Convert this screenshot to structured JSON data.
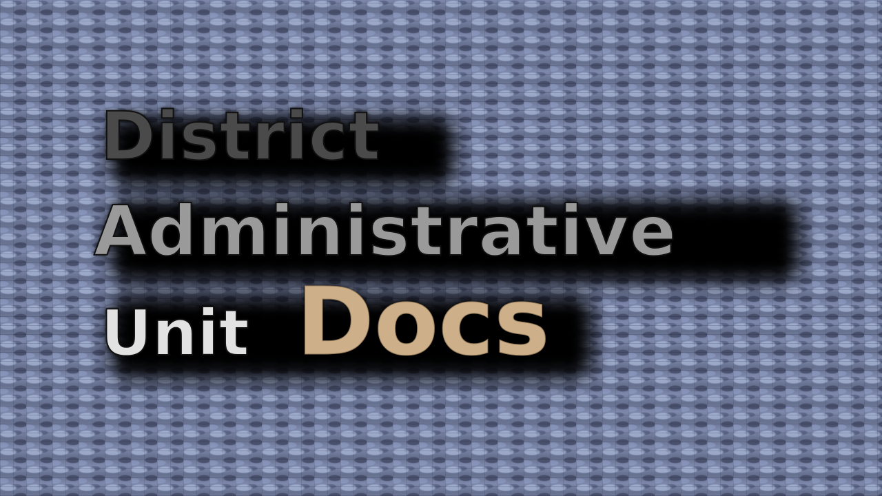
{
  "title": {
    "line1": "District",
    "line2": "Administrative",
    "line3_part1": "Unit",
    "line3_part2": "Docs"
  },
  "colors": {
    "background": "#6f7a9c",
    "district_text": "#4a4a4a",
    "administrative_text": "#9a9a9a",
    "unit_text": "#e2e2e2",
    "docs_text": "#cdb089",
    "shadow": "#000000"
  }
}
